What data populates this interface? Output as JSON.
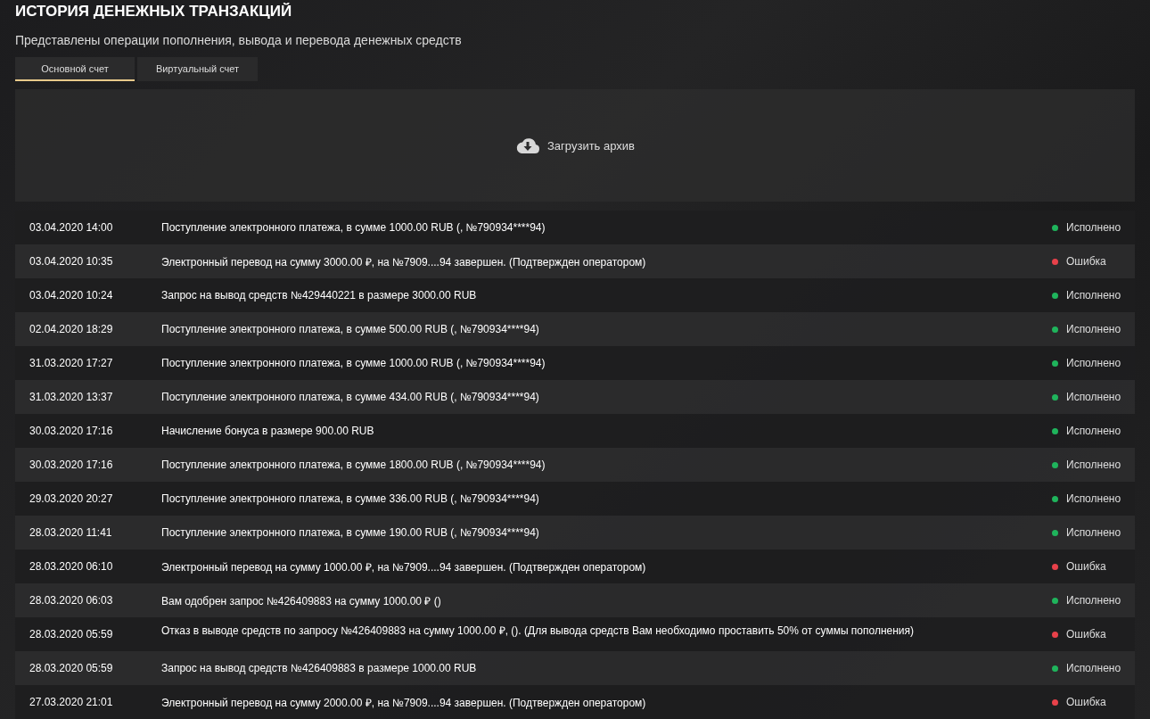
{
  "title": "ИСТОРИЯ ДЕНЕЖНЫХ ТРАНЗАКЦИЙ",
  "subtitle": "Представлены операции пополнения, вывода и перевода денежных средств",
  "tabs": [
    {
      "label": "Основной счет",
      "selected": true
    },
    {
      "label": "Виртуальный счет",
      "selected": false
    }
  ],
  "archive_button": {
    "label": "Загрузить архив"
  },
  "transactions": [
    {
      "date": "03.04.2020 14:00",
      "description": "Поступление электронного платежа, в сумме 1000.00 RUB (, №790934****94)",
      "status": "Исполнено",
      "color": "#1fb45c"
    },
    {
      "date": "03.04.2020 10:35",
      "description": "Электронный перевод на сумму 3000.00 ₽, на №7909....94 завершен. (Подтвержден оператором)",
      "status": "Ошибка",
      "color": "#e8414a"
    },
    {
      "date": "03.04.2020 10:24",
      "description": "Запрос на вывод средств №429440221 в размере 3000.00 RUB",
      "status": "Исполнено",
      "color": "#1fb45c"
    },
    {
      "date": "02.04.2020 18:29",
      "description": "Поступление электронного платежа, в сумме 500.00 RUB (, №790934****94)",
      "status": "Исполнено",
      "color": "#1fb45c"
    },
    {
      "date": "31.03.2020 17:27",
      "description": "Поступление электронного платежа, в сумме 1000.00 RUB (, №790934****94)",
      "status": "Исполнено",
      "color": "#1fb45c"
    },
    {
      "date": "31.03.2020 13:37",
      "description": "Поступление электронного платежа, в сумме 434.00 RUB (, №790934****94)",
      "status": "Исполнено",
      "color": "#1fb45c"
    },
    {
      "date": "30.03.2020 17:16",
      "description": "Начисление бонуса в размере 900.00 RUB",
      "status": "Исполнено",
      "color": "#1fb45c"
    },
    {
      "date": "30.03.2020 17:16",
      "description": "Поступление электронного платежа, в сумме 1800.00 RUB (, №790934****94)",
      "status": "Исполнено",
      "color": "#1fb45c"
    },
    {
      "date": "29.03.2020 20:27",
      "description": "Поступление электронного платежа, в сумме 336.00 RUB (, №790934****94)",
      "status": "Исполнено",
      "color": "#1fb45c"
    },
    {
      "date": "28.03.2020 11:41",
      "description": "Поступление электронного платежа, в сумме 190.00 RUB (, №790934****94)",
      "status": "Исполнено",
      "color": "#1fb45c"
    },
    {
      "date": "28.03.2020 06:10",
      "description": "Электронный перевод на сумму 1000.00 ₽, на №7909....94 завершен. (Подтвержден оператором)",
      "status": "Ошибка",
      "color": "#e8414a"
    },
    {
      "date": "28.03.2020 06:03",
      "description": "Вам одобрен запрос №426409883 на сумму 1000.00 ₽ ()",
      "status": "Исполнено",
      "color": "#1fb45c"
    },
    {
      "date": "28.03.2020 05:59",
      "description": "Отказ в выводе средств по запросу №426409883 на сумму 1000.00 ₽, (). (Для вывода средств Вам необходимо проставить 50% от суммы пополнения)",
      "status": "Ошибка",
      "color": "#e8414a",
      "top_aligned": true
    },
    {
      "date": "28.03.2020 05:59",
      "description": "Запрос на вывод средств №426409883 в размере 1000.00 RUB",
      "status": "Исполнено",
      "color": "#1fb45c"
    },
    {
      "date": "27.03.2020 21:01",
      "description": "Электронный перевод на сумму 2000.00 ₽, на №7909....94 завершен. (Подтвержден оператором)",
      "status": "Ошибка",
      "color": "#e8414a"
    }
  ]
}
